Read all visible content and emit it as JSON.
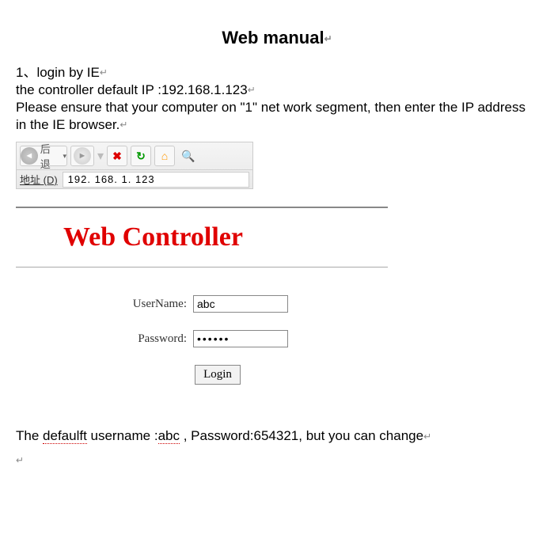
{
  "title": "Web manual",
  "instructions": {
    "line1": "1、login by IE",
    "line2": "the controller default IP :192.168.1.123",
    "line3": "Please ensure that your computer on \"1\" net work segment, then enter the IP address in the IE browser."
  },
  "ie_bar": {
    "back_label": "后退",
    "address_label": "地址 (D)",
    "address_value": "192. 168. 1. 123"
  },
  "controller_heading": "Web Controller",
  "form": {
    "username_label": "UserName:",
    "username_value": "abc",
    "password_label": "Password:",
    "password_value": "••••••",
    "login_button": "Login"
  },
  "footer": {
    "prefix": "The ",
    "defaulft": "defaulft",
    "mid1": " username :",
    "abc": "abc",
    "mid2": " , Password:654321, but you can change"
  }
}
